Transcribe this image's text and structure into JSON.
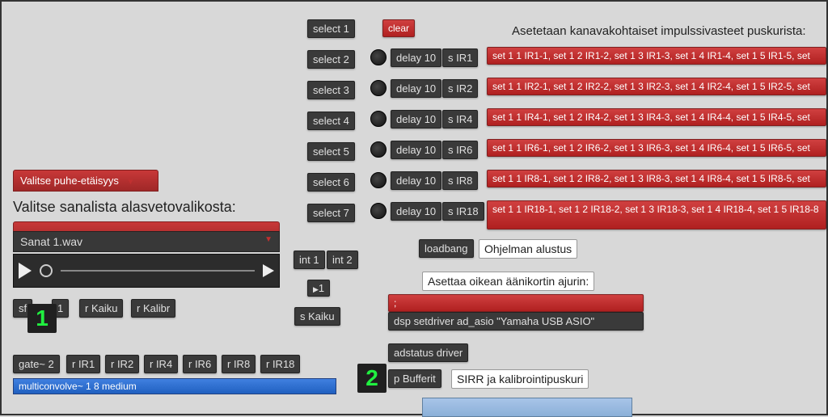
{
  "selects": [
    "select 1",
    "select 2",
    "select 3",
    "select 4",
    "select 5",
    "select 6",
    "select 7"
  ],
  "clear": "clear",
  "delays": [
    "delay 10",
    "delay 10",
    "delay 10",
    "delay 10",
    "delay 10",
    "delay 10",
    "delay 10"
  ],
  "sirs": [
    "s IR1",
    "s IR2",
    "s IR4",
    "s IR6",
    "s IR8",
    "s IR18"
  ],
  "ir_set_header": "Asetetaan kanavakohtaiset impulssivasteet puskurista:",
  "ir_rows": [
    "set 1 1 IR1-1, set 1 2 IR1-2, set 1 3 IR1-3, set 1 4 IR1-4, set 1 5 IR1-5, set",
    "set 1 1 IR2-1, set 1 2 IR2-2, set 1 3 IR2-3, set 1 4 IR2-4, set 1 5 IR2-5, set",
    "set 1 1 IR4-1, set 1 2 IR4-2, set 1 3 IR4-3, set 1 4 IR4-4, set 1 5 IR4-5, set",
    "set 1 1 IR6-1, set 1 2 IR6-2, set 1 3 IR6-3, set 1 4 IR6-4, set 1 5 IR6-5, set",
    "set 1 1 IR8-1, set 1 2 IR8-2, set 1 3 IR8-3, set 1 4 IR8-4, set 1 5 IR8-5, set",
    "set 1 1 IR18-1, set 1 2 IR18-2, set 1 3 IR18-3, set 1 4 IR18-4, set 1 5 IR18-8"
  ],
  "dropdown_label": "Valitse puhe-etäisyys",
  "wordlist_label": "Valitse sanalista alasvetovalikosta:",
  "sanat_dropdown": "Sanat 1.wav",
  "int1": "int 1",
  "int2": "int 2",
  "one": "1",
  "s_kaiku": "s Kaiku",
  "sf": "sf",
  "sf1": "1",
  "r_kaiku": "r Kaiku",
  "r_kalibr": "r Kalibr",
  "loadbang": "loadbang",
  "ohjelman": "Ohjelman alustus",
  "asettaa": "Asettaa oikean äänikortin ajurin:",
  "semicolon": ";",
  "dsp": "dsp setdriver ad_asio \"Yamaha USB ASIO\"",
  "adstatus": "adstatus driver",
  "p_bufferit": "p Bufferit",
  "sirr": "SIRR ja kalibrointipuskuri",
  "gate": "gate~ 2",
  "rirs": [
    "r IR1",
    "r IR2",
    "r IR4",
    "r IR6",
    "r IR8",
    "r IR18"
  ],
  "multiconv": "multiconvolve~ 1 8 medium",
  "marker1": "1",
  "marker2": "2"
}
